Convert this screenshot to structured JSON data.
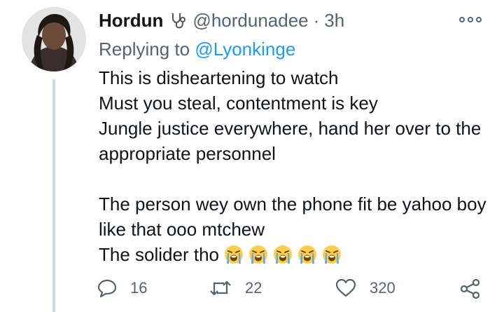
{
  "tweet": {
    "author_name": "Hordun",
    "name_emoji": "stethoscope-emoji",
    "handle": "@hordunadee",
    "separator": "·",
    "time": "3h",
    "replying_prefix": "Replying to",
    "replying_mention": "@Lyonkinge",
    "lines": [
      "This is disheartening to watch",
      "Must you steal, contentment is key",
      "Jungle justice everywhere, hand her over to the appropriate personnel",
      "",
      "The person wey own the phone fit be yahoo boy like that ooo mtchew",
      "The solider tho"
    ],
    "trailing_emoji": [
      "loudly-crying-face",
      "loudly-crying-face",
      "loudly-crying-face",
      "loudly-crying-face",
      "loudly-crying-face"
    ]
  },
  "actions": {
    "replies": "16",
    "retweets": "22",
    "likes": "320"
  },
  "colors": {
    "text": "#0f1419",
    "secondary": "#536471",
    "link": "#1d9bf0",
    "thread_line": "#cfd9de"
  }
}
